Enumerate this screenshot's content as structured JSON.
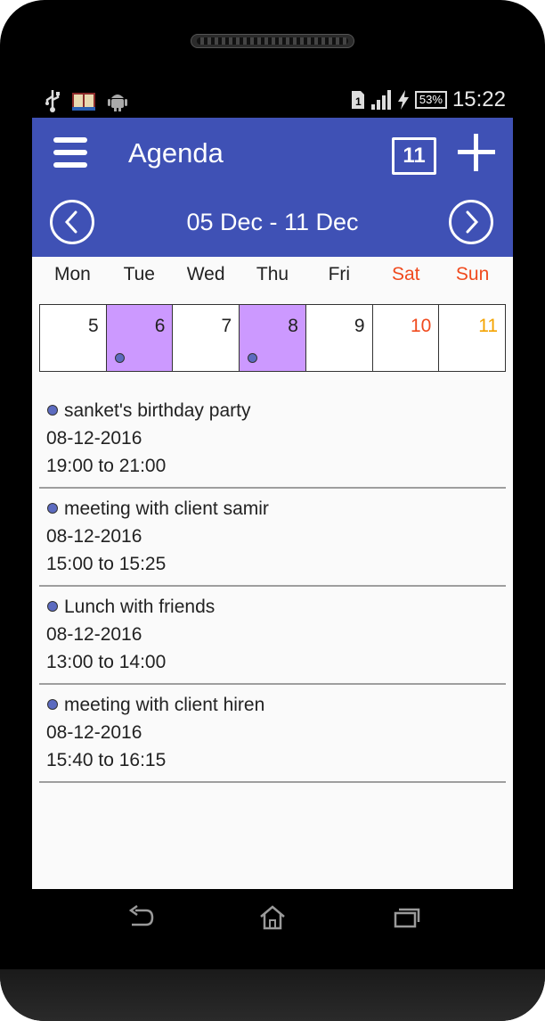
{
  "status_bar": {
    "time": "15:22",
    "battery_percent": "53%",
    "sim_slot": "1",
    "left_icons": [
      "usb-icon",
      "book-app-icon",
      "android-icon"
    ],
    "right_icons": [
      "signal-icon",
      "charging-icon",
      "battery-icon"
    ]
  },
  "appbar": {
    "title": "Agenda",
    "today_label": "11",
    "menu_icon": "hamburger-menu-icon",
    "add_icon": "plus-icon"
  },
  "week": {
    "range_label": "05 Dec - 11 Dec",
    "prev_icon": "chevron-left-icon",
    "next_icon": "chevron-right-icon",
    "days": [
      {
        "name": "Mon",
        "date": "5",
        "has_event": false
      },
      {
        "name": "Tue",
        "date": "6",
        "has_event": true
      },
      {
        "name": "Wed",
        "date": "7",
        "has_event": false
      },
      {
        "name": "Thu",
        "date": "8",
        "has_event": true
      },
      {
        "name": "Fri",
        "date": "9",
        "has_event": false
      },
      {
        "name": "Sat",
        "date": "10",
        "has_event": false
      },
      {
        "name": "Sun",
        "date": "11",
        "has_event": false
      }
    ]
  },
  "events": [
    {
      "name": "sanket's birthday party",
      "date": "08-12-2016",
      "time": "19:00 to 21:00"
    },
    {
      "name": "meeting with client samir",
      "date": "08-12-2016",
      "time": "15:00 to 15:25"
    },
    {
      "name": "Lunch with friends",
      "date": "08-12-2016",
      "time": "13:00 to 14:00"
    },
    {
      "name": "meeting with client hiren",
      "date": "08-12-2016",
      "time": "15:40 to 16:15"
    }
  ],
  "colors": {
    "primary": "#3f51b5",
    "event_day_highlight": "#cc99ff",
    "event_dot": "#5c6bc0",
    "saturday": "#f04a1e",
    "sunday_date": "#f4a300",
    "background": "#fafafa"
  },
  "nav_bar": [
    "back-icon",
    "home-icon",
    "recent-apps-icon"
  ]
}
